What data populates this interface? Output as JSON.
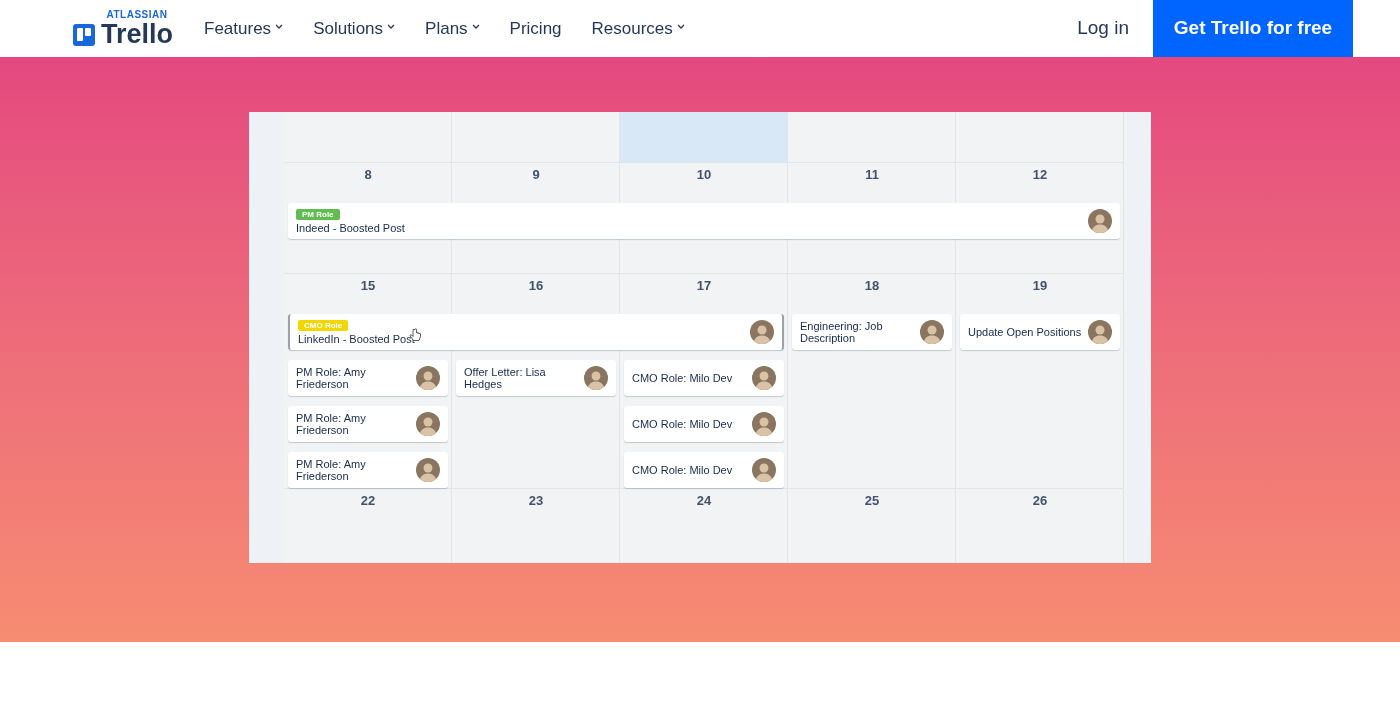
{
  "nav": {
    "brand_top": "ATLASSIAN",
    "brand": "Trello",
    "links": [
      {
        "label": "Features",
        "dropdown": true
      },
      {
        "label": "Solutions",
        "dropdown": true
      },
      {
        "label": "Plans",
        "dropdown": true
      },
      {
        "label": "Pricing",
        "dropdown": false
      },
      {
        "label": "Resources",
        "dropdown": true
      }
    ],
    "login": "Log in",
    "cta": "Get Trello for free"
  },
  "calendar": {
    "top_row": [
      {
        "highlighted": false
      },
      {
        "highlighted": false
      },
      {
        "highlighted": true
      },
      {
        "highlighted": false
      },
      {
        "highlighted": false
      }
    ],
    "weeks": [
      {
        "days": [
          "8",
          "9",
          "10",
          "11",
          "12"
        ],
        "lanes": [
          [
            {
              "kind": "week",
              "label": "PM Role",
              "color": "#61bd4f",
              "title": "Indeed - Boosted Post",
              "dragging": false
            }
          ]
        ]
      },
      {
        "days": [
          "15",
          "16",
          "17",
          "18",
          "19"
        ],
        "lanes": [
          [
            {
              "kind": "triple",
              "label": "CMO Role",
              "color": "#f2d600",
              "title": "LinkedIn - Boosted Post",
              "dragging": true
            },
            {
              "kind": "day",
              "title": "Engineering: Job Description",
              "dragging": false
            },
            {
              "kind": "day",
              "title": "Update Open Positions",
              "dragging": false
            }
          ],
          [
            {
              "kind": "day",
              "title": "PM Role: Amy Friederson",
              "dragging": false
            },
            {
              "kind": "day",
              "title": "Offer Letter: Lisa Hedges",
              "dragging": false
            },
            {
              "kind": "day",
              "title": "CMO Role: Milo Dev",
              "dragging": false
            }
          ],
          [
            {
              "kind": "day",
              "title": "PM Role: Amy Friederson",
              "dragging": false
            },
            {
              "kind": "gap"
            },
            {
              "kind": "day",
              "title": "CMO Role: Milo Dev",
              "dragging": false
            }
          ],
          [
            {
              "kind": "day",
              "title": "PM Role: Amy Friederson",
              "dragging": false
            },
            {
              "kind": "gap"
            },
            {
              "kind": "day",
              "title": "CMO Role: Milo Dev",
              "dragging": false
            }
          ]
        ]
      },
      {
        "days": [
          "22",
          "23",
          "24",
          "25",
          "26"
        ]
      }
    ]
  }
}
